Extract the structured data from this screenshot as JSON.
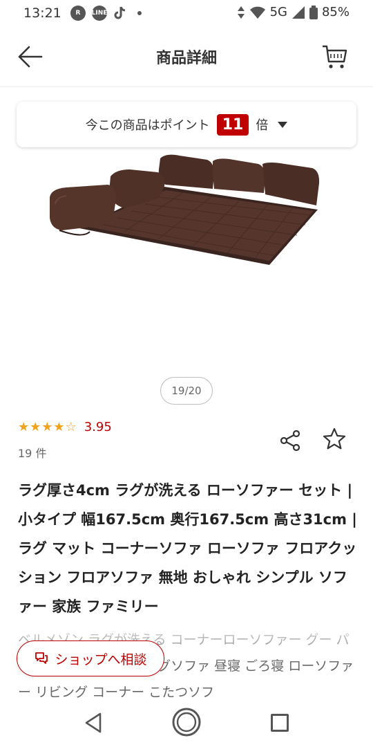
{
  "status_bar": {
    "time": "13:21",
    "network": "5G",
    "battery": "85%",
    "left_icons": [
      "rakuten-link-icon",
      "line-icon",
      "tiktok-icon",
      "dot-icon"
    ],
    "right_icons": [
      "data-arrows-icon",
      "wifi-icon",
      "signal-icon",
      "battery-icon"
    ]
  },
  "header": {
    "title": "商品詳細",
    "back_icon": "arrow-left-icon",
    "cart_icon": "cart-icon"
  },
  "points_banner": {
    "prefix": "今この商品はポイント",
    "multiplier": "11",
    "suffix": "倍"
  },
  "gallery": {
    "counter": "19/20"
  },
  "rating": {
    "value": "3.95",
    "stars_filled": 4,
    "review_count": "19 件"
  },
  "product": {
    "title": "ラグ厚さ4cm ラグが洗える ローソファー セット | 小タイプ 幅167.5cm 奥行167.5cm 高さ31cm | ラグ マット コーナーソファ ローソファ フロアクッション フロアソファ 無地 おしゃれ シンプル  ソファー 家族 ファミリー",
    "description": "ベルメゾン ラグが洗える コーナーローソファー グー パー カーペットソファ ラグソファ 昼寝 ごろ寝 ローソファー リビング コーナー こたつソフ"
  },
  "consult_button": {
    "label": "ショップへ相談"
  },
  "colors": {
    "accent": "#bf0000",
    "star": "#f2a11a",
    "sofa": "#4a2e25"
  }
}
